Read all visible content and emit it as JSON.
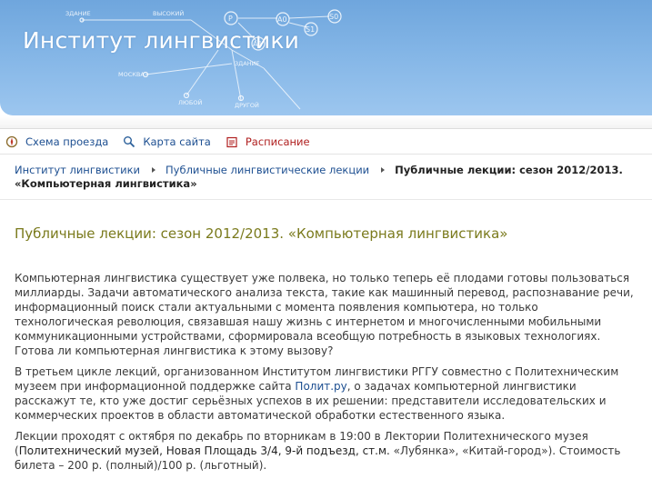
{
  "header": {
    "title": "Институт лингвистики",
    "graph": {
      "nodes": [
        "P",
        "A0",
        "S0",
        "S1",
        "A1"
      ],
      "labels": [
        "ЗДАНИЕ",
        "ВЫСОКИЙ",
        "МОСКВА",
        "ЗДАНИЕ",
        "ЛЮБОЙ",
        "ДРУГОЙ"
      ]
    }
  },
  "quicklinks": [
    {
      "label": "Схема проезда",
      "icon": "compass-icon"
    },
    {
      "label": "Карта сайта",
      "icon": "magnifier-icon"
    },
    {
      "label": "Расписание",
      "icon": "calendar-icon"
    }
  ],
  "breadcrumb": {
    "items": [
      "Институт лингвистики",
      "Публичные лингвистические лекции"
    ],
    "current": "Публичные лекции: сезон 2012/2013. «Компьютерная лингвистика»"
  },
  "page": {
    "title": "Публичные лекции: сезон 2012/2013. «Компьютерная лингвистика»",
    "p1": "Компьютерная лингвистика существует уже полвека, но только теперь её плодами готовы пользоваться миллиарды. Задачи автоматического анализа текста, такие как машинный перевод,  распознавание речи, информационный поиск стали актуальными с момента появления компьютера, но только технологическая революция, связавшая нашу жизнь с интернетом и многочисленными мобильными коммуникационными устройствами, сформировала всеобщую потребность в языковых технологиях. Готова ли компьютерная лингвистика к этому вызову?",
    "p2_before": "В третьем цикле лекций, организованном Институтом лингвистики РГГУ совместно с Политехническим музеем при информационной поддержке сайта ",
    "p2_link": "Полит.ру",
    "p2_after": ", о задачах компьютерной лингвистики расскажут те, кто уже достиг серьёзных успехов в их решении: представители исследовательских и коммерческих проектов в области автоматической обработки естественного языка.",
    "p3_before": "Лекции проходят с октября по декабрь по вторникам в 19:00 в Лектории Политехнического музея (",
    "p3_address": "Политехнический музей, Новая Площадь 3/4, 9-й подъезд, ст.м. ",
    "p3_metro": "«Лубянка», «Китай-город»",
    "p3_after": "). Стоимость билета – 200 р. (полный)/100 р. (льготный)."
  }
}
